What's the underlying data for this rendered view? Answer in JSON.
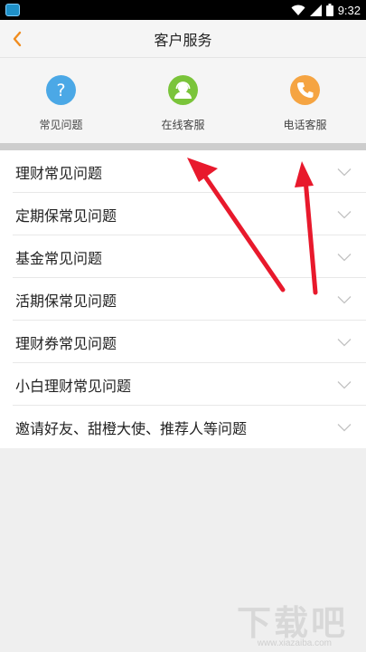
{
  "status_bar": {
    "time": "9:32"
  },
  "header": {
    "title": "客户服务"
  },
  "services": [
    {
      "label": "常见问题",
      "icon": "help-icon",
      "color": "#4ba8e6"
    },
    {
      "label": "在线客服",
      "icon": "agent-icon",
      "color": "#7ac43a"
    },
    {
      "label": "电话客服",
      "icon": "phone-icon",
      "color": "#f5a442"
    }
  ],
  "faq": [
    {
      "label": "理财常见问题"
    },
    {
      "label": "定期保常见问题"
    },
    {
      "label": "基金常见问题"
    },
    {
      "label": "活期保常见问题"
    },
    {
      "label": "理财券常见问题"
    },
    {
      "label": "小白理财常见问题"
    },
    {
      "label": "邀请好友、甜橙大使、推荐人等问题"
    }
  ],
  "colors": {
    "accent_back": "#f08c1e",
    "annotation_arrow": "#e8192c"
  },
  "watermark": {
    "text": "下载吧",
    "url": "www.xiazaiba.com"
  }
}
